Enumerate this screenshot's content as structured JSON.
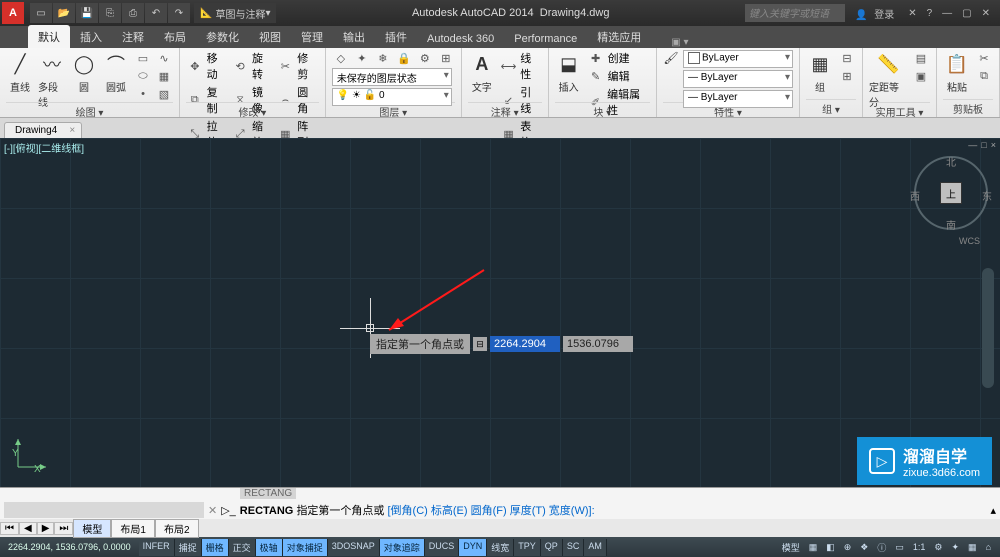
{
  "title": {
    "app": "Autodesk AutoCAD 2014",
    "doc": "Drawing4.dwg"
  },
  "search_placeholder": "键入关键字或短语",
  "login_label": "登录",
  "qat_tip": "草图与注释",
  "ribbon_tabs": [
    "默认",
    "插入",
    "注释",
    "布局",
    "参数化",
    "视图",
    "管理",
    "输出",
    "插件",
    "Autodesk 360",
    "Performance",
    "精选应用"
  ],
  "panels": {
    "draw": {
      "label": "绘图 ▾",
      "items": [
        "直线",
        "多段线",
        "圆",
        "圆弧"
      ]
    },
    "modify": {
      "label": "修改 ▾",
      "items": [
        "移动",
        "复制",
        "拉伸",
        "旋转",
        "镜像",
        "缩放",
        "修剪",
        "圆角",
        "阵列"
      ]
    },
    "layer": {
      "label": "图层 ▾",
      "state": "未保存的图层状态",
      "current": "0"
    },
    "anno": {
      "label": "注释 ▾",
      "item": "文字",
      "line": "线性",
      "lead": "引线",
      "table": "表格"
    },
    "block": {
      "label": "块 ▾",
      "item": "插入",
      "create": "创建",
      "edit": "编辑",
      "attr": "编辑属性"
    },
    "props": {
      "label": "特性 ▾",
      "layer": "ByLayer",
      "color": "ByLayer",
      "lw": "ByLayer"
    },
    "group": {
      "label": "组 ▾",
      "item": "组"
    },
    "util": {
      "label": "实用工具 ▾",
      "item": "定距等分"
    },
    "clip": {
      "label": "剪贴板",
      "item": "粘贴"
    }
  },
  "file_tab": "Drawing4",
  "view_label": "[-][俯视][二维线框]",
  "navcube": {
    "top": "上",
    "n": "北",
    "s": "南",
    "e": "东",
    "w": "西",
    "wcs": "WCS"
  },
  "dyn": {
    "prompt": "指定第一个角点或",
    "x": "2264.2904",
    "y": "1536.0796"
  },
  "ucs": {
    "y": "Y",
    "x": "X"
  },
  "watermark": {
    "brand": "溜溜自学",
    "url": "zixue.3d66.com"
  },
  "cmd": {
    "hist": "RECTANG",
    "cmd": "RECTANG",
    "prompt": "指定第一个角点或",
    "opts": "[倒角(C) 标高(E) 圆角(F) 厚度(T) 宽度(W)]:"
  },
  "layout_tabs": [
    "模型",
    "布局1",
    "布局2"
  ],
  "status": {
    "coords": "2264.2904, 1536.0796, 0.0000",
    "buttons": [
      "INFER",
      "捕捉",
      "栅格",
      "正交",
      "极轴",
      "对象捕捉",
      "3DOSNAP",
      "对象追踪",
      "DUCS",
      "DYN",
      "线宽",
      "TPY",
      "QP",
      "SC",
      "AM"
    ],
    "on": [
      2,
      4,
      5,
      7,
      9
    ],
    "right": [
      "模型",
      "▦",
      "◧",
      "⊕",
      "❖",
      "ⓘ",
      "▭",
      "1:1",
      "⚙",
      "✦",
      "▦",
      "⌂"
    ]
  }
}
